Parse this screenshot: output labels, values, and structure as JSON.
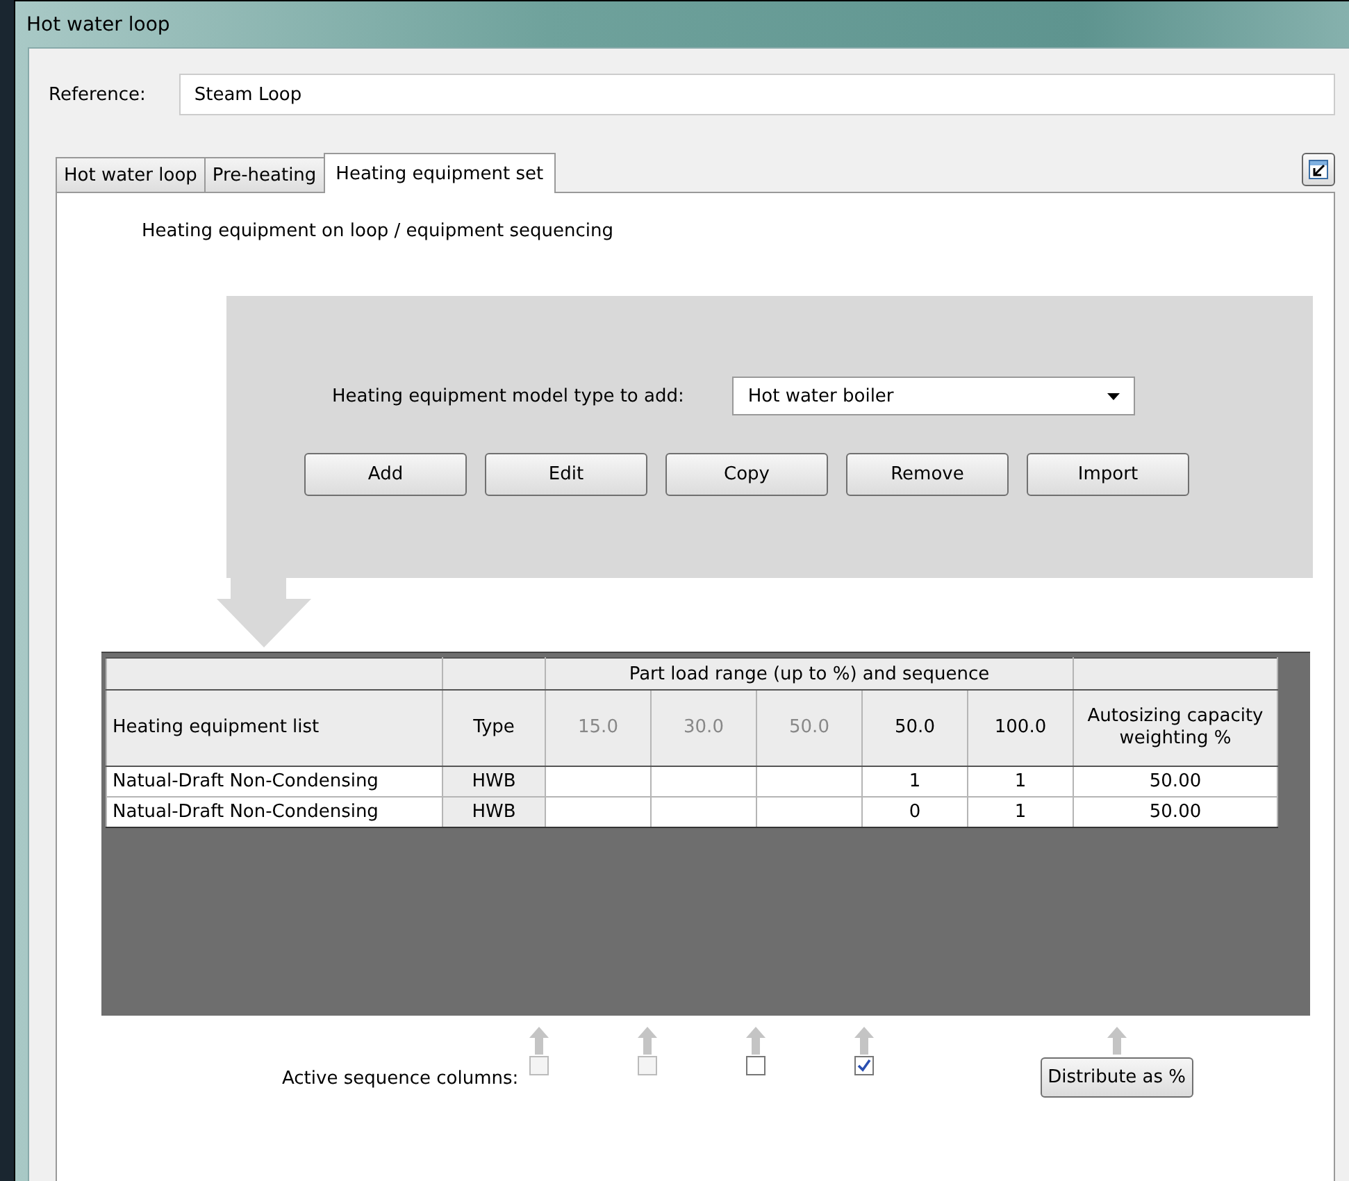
{
  "window": {
    "title": "Hot water loop"
  },
  "reference": {
    "label": "Reference:",
    "value": "Steam Loop"
  },
  "tabs": [
    {
      "label": "Hot water loop",
      "selected": false
    },
    {
      "label": "Pre-heating",
      "selected": false
    },
    {
      "label": "Heating equipment set",
      "selected": true
    }
  ],
  "caption": "Heating equipment on loop / equipment sequencing",
  "model_type": {
    "label": "Heating equipment model type to add:",
    "value": "Hot water boiler"
  },
  "buttons": [
    "Add",
    "Edit",
    "Copy",
    "Remove",
    "Import"
  ],
  "table": {
    "group_header": "Part load range (up to %) and sequence",
    "columns": [
      {
        "label": "Heating equipment list",
        "kind": "name"
      },
      {
        "label": "Type",
        "kind": "type"
      },
      {
        "label": "15.0",
        "kind": "load",
        "active": false
      },
      {
        "label": "30.0",
        "kind": "load",
        "active": false
      },
      {
        "label": "50.0",
        "kind": "load",
        "active": false
      },
      {
        "label": "50.0",
        "kind": "load",
        "active": true,
        "values": [
          "1",
          "0"
        ]
      },
      {
        "label": "100.0",
        "kind": "load",
        "active": true,
        "values": [
          "1",
          "1"
        ]
      },
      {
        "label": "Autosizing capacity weighting %",
        "kind": "weight"
      }
    ],
    "rows": [
      {
        "name": "Natual-Draft Non-Condensing",
        "type": "HWB",
        "weighting": "50.00"
      },
      {
        "name": "Natual-Draft Non-Condensing",
        "type": "HWB",
        "weighting": "50.00"
      }
    ]
  },
  "active_columns": {
    "label": "Active sequence columns:",
    "checkboxes": [
      {
        "checked": false,
        "disabled": true
      },
      {
        "checked": false,
        "disabled": true
      },
      {
        "checked": false,
        "disabled": false
      },
      {
        "checked": true,
        "disabled": false
      }
    ]
  },
  "distribute_button": "Distribute as %"
}
